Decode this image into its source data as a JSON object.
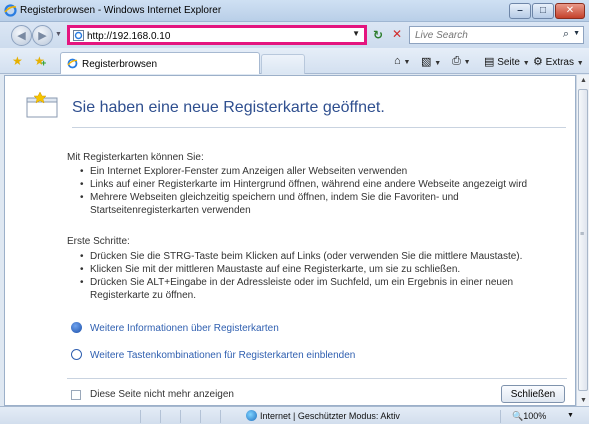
{
  "window": {
    "title": "Registerbrowsen - Windows Internet Explorer"
  },
  "address_bar": {
    "url": "http://192.168.0.10"
  },
  "search": {
    "placeholder": "Live Search"
  },
  "tabs": [
    {
      "label": "Registerbrowsen",
      "active": true
    }
  ],
  "command_bar": {
    "page_label": "Seite",
    "extras_label": "Extras"
  },
  "content": {
    "heading": "Sie haben eine neue Registerkarte geöffnet.",
    "section1": {
      "title": "Mit Registerkarten können Sie:",
      "items": [
        "Ein Internet Explorer-Fenster zum Anzeigen aller Webseiten verwenden",
        "Links auf einer Registerkarte im Hintergrund öffnen, während eine andere Webseite angezeigt wird",
        "Mehrere Webseiten gleichzeitig speichern und öffnen, indem Sie die Favoriten- und Startseitenregisterkarten verwenden"
      ]
    },
    "section2": {
      "title": "Erste Schritte:",
      "items": [
        "Drücken Sie die STRG-Taste beim Klicken auf Links (oder verwenden Sie die mittlere Maustaste).",
        "Klicken Sie mit der mittleren Maustaste auf eine Registerkarte, um sie zu schließen.",
        "Drücken Sie ALT+Eingabe in der Adressleiste oder im Suchfeld, um ein Ergebnis in einer neuen Registerkarte zu öffnen."
      ]
    },
    "links": [
      {
        "label": "Weitere Informationen über Registerkarten",
        "icon": "help-icon"
      },
      {
        "label": "Weitere Tastenkombinationen für Registerkarten einblenden",
        "icon": "expand-circle-icon"
      }
    ],
    "dont_show_label": "Diese Seite nicht mehr anzeigen",
    "close_label": "Schließen"
  },
  "status": {
    "text": "Internet | Geschützter Modus: Aktiv",
    "zoom": "100%"
  },
  "colors": {
    "highlight_border": "#e4157f",
    "link": "#2f5fb0",
    "heading": "#2f4f8f"
  }
}
